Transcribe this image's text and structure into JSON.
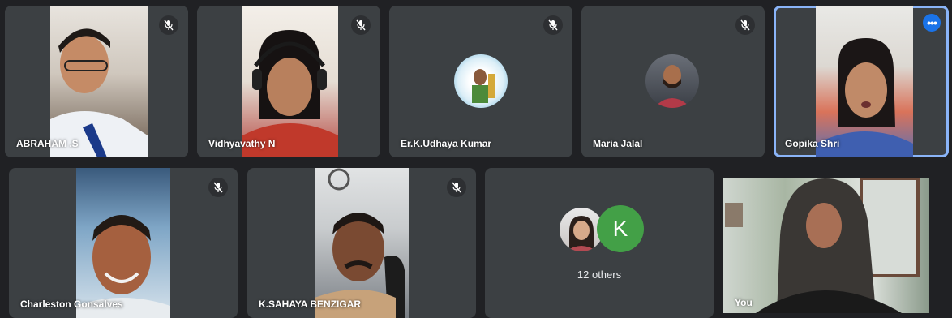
{
  "colors": {
    "background": "#202124",
    "tile": "#3c4043",
    "active_outline": "#8ab4f8",
    "more_button": "#1a73e8",
    "k_avatar": "#43a047"
  },
  "icons": {
    "muted_mic": "mic-off-icon",
    "more_options": "more-options-icon"
  },
  "participants": [
    {
      "name": "ABRAHAM .S",
      "muted": true
    },
    {
      "name": "Vidhyavathy N",
      "muted": true
    },
    {
      "name": "Er.K.Udhaya Kumar",
      "muted": true
    },
    {
      "name": "Maria Jalal",
      "muted": true
    },
    {
      "name": "Gopika Shri",
      "muted": false,
      "speaking": true
    },
    {
      "name": "Charleston Gonsalves",
      "muted": true
    },
    {
      "name": "K.SAHAYA BENZIGAR",
      "muted": true
    },
    {
      "name": "You",
      "muted": false
    }
  ],
  "others": {
    "label": "12 others",
    "avatar_letter": "K"
  },
  "more_button_glyph": "•••"
}
